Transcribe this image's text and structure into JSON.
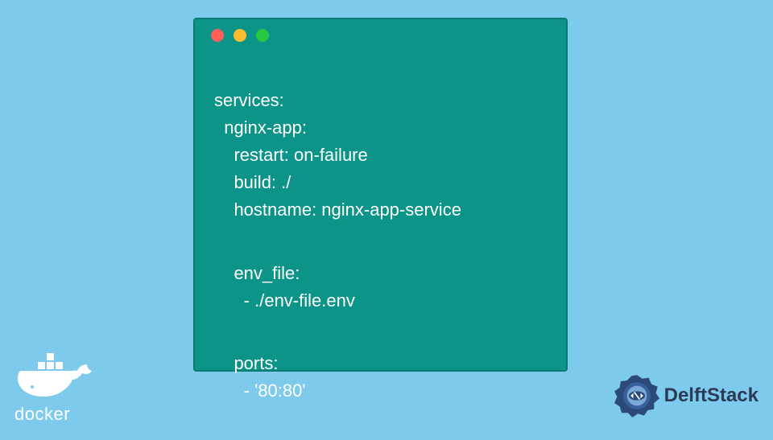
{
  "code": {
    "lines": [
      "services:",
      "  nginx-app:",
      "    restart: on-failure",
      "    build: ./",
      "    hostname: nginx-app-service",
      "    env_file:",
      "      - ./env-file.env",
      "    ports:",
      "      - '80:80'"
    ]
  },
  "logos": {
    "docker": "docker",
    "delftstack": "DelftStack"
  },
  "colors": {
    "background": "#7ecaed",
    "window": "#0d9488",
    "text": "#ffffff"
  }
}
